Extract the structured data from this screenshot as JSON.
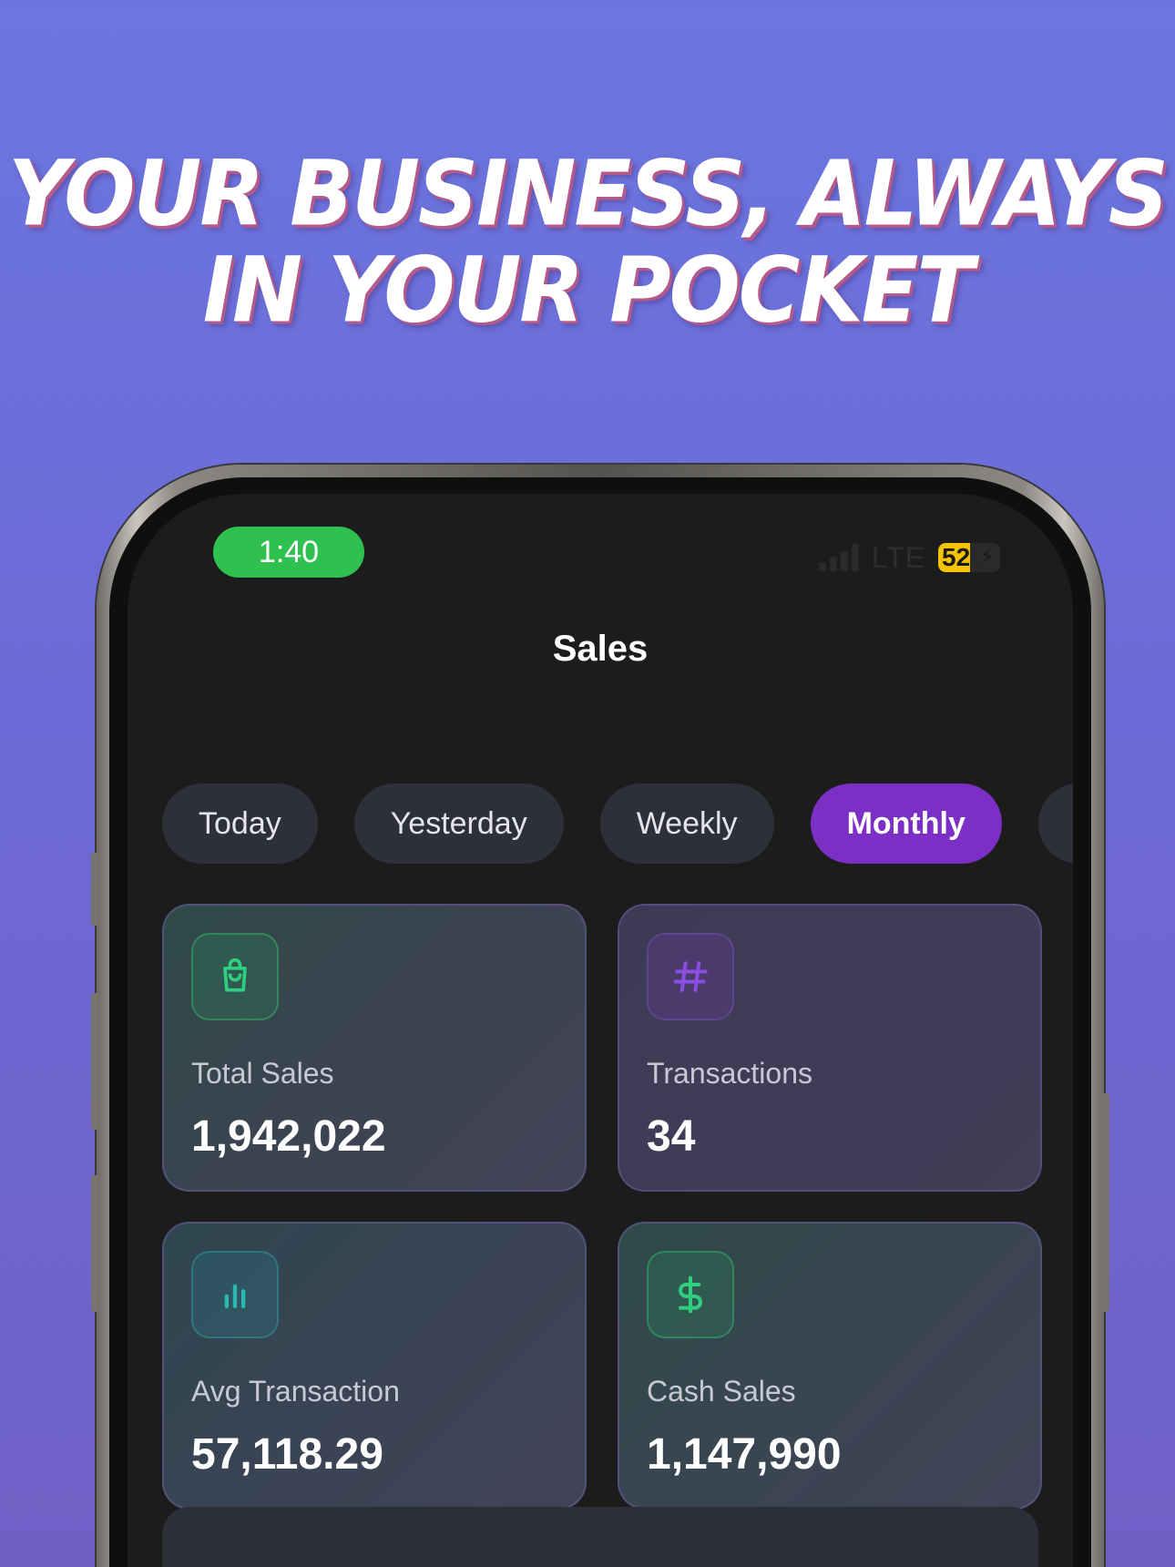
{
  "headline": {
    "line1": "YOUR BUSINESS, ALWAYS",
    "line2": "IN YOUR POCKET"
  },
  "status_bar": {
    "time": "1:40",
    "network": "LTE",
    "battery": "52",
    "battery_level": 0.52,
    "icons": {
      "signal": "signal-bars-icon",
      "charging": "bolt-icon"
    }
  },
  "header": {
    "title": "Sales"
  },
  "filters": {
    "tabs": [
      "Today",
      "Yesterday",
      "Weekly",
      "Monthly"
    ],
    "active": "Monthly"
  },
  "stats": [
    {
      "label": "Total Sales",
      "value": "1,942,022",
      "icon": "shopping-bag-icon",
      "accent": "#2fcf7f"
    },
    {
      "label": "Transactions",
      "value": "34",
      "icon": "hash-icon",
      "accent": "#7a3fd0"
    },
    {
      "label": "Avg Transaction",
      "value": "57,118.29",
      "icon": "bar-chart-icon",
      "accent": "#2ab8b0"
    },
    {
      "label": "Cash Sales",
      "value": "1,147,990",
      "icon": "dollar-icon",
      "accent": "#2fcf7f"
    }
  ],
  "colors": {
    "background_top": "#6b76de",
    "background_bottom": "#7060c6",
    "active_tab": "#7b2fc5",
    "time_pill": "#2fc14f",
    "battery": "#f5c400"
  }
}
